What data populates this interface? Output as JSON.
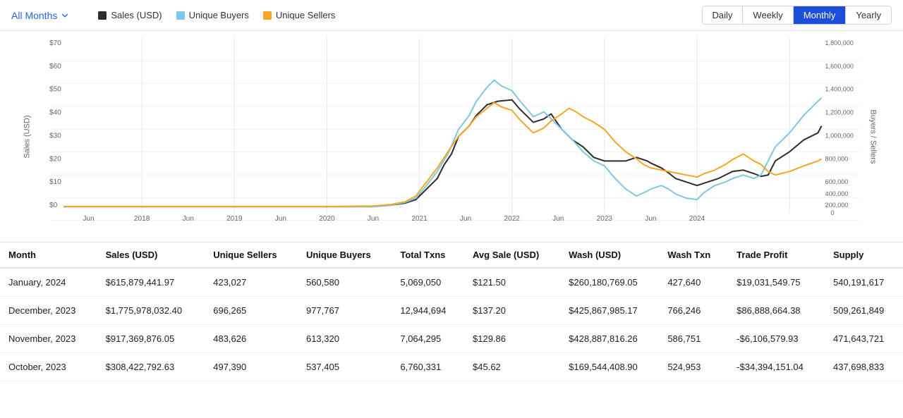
{
  "header": {
    "filter_label": "All Months",
    "period_buttons": [
      "Daily",
      "Weekly",
      "Monthly",
      "Yearly"
    ],
    "active_period": "Monthly"
  },
  "legend": [
    {
      "label": "Sales (USD)",
      "color": "#2d2d2d"
    },
    {
      "label": "Unique Buyers",
      "color": "#7ec8e3"
    },
    {
      "label": "Unique Sellers",
      "color": "#f5a623"
    }
  ],
  "chart": {
    "y_axis_left_label": "Sales (USD)",
    "y_axis_right_label": "Buyers / Sellers",
    "y_ticks_left": [
      "$70",
      "$60",
      "$50",
      "$40",
      "$30",
      "$20",
      "$10",
      "$0"
    ],
    "y_ticks_right": [
      "1,800,000",
      "1,600,000",
      "1,400,000",
      "1,200,000",
      "1,000,000",
      "800,000",
      "600,000",
      "400,000",
      "200,000",
      "0"
    ],
    "x_ticks": [
      "Jun",
      "2018",
      "Jun",
      "2019",
      "Jun",
      "2020",
      "Jun",
      "2021",
      "Jun",
      "2022",
      "Jun",
      "2023",
      "Jun",
      "2024"
    ]
  },
  "table": {
    "columns": [
      "Month",
      "Sales (USD)",
      "Unique Sellers",
      "Unique Buyers",
      "Total Txns",
      "Avg Sale (USD)",
      "Wash (USD)",
      "Wash Txn",
      "Trade Profit",
      "Supply"
    ],
    "rows": [
      [
        "January, 2024",
        "$615,879,441.97",
        "423,027",
        "560,580",
        "5,069,050",
        "$121.50",
        "$260,180,769.05",
        "427,640",
        "$19,031,549.75",
        "540,191,617"
      ],
      [
        "December, 2023",
        "$1,775,978,032.40",
        "696,265",
        "977,767",
        "12,944,694",
        "$137.20",
        "$425,867,985.17",
        "766,246",
        "$86,888,664.38",
        "509,261,849"
      ],
      [
        "November, 2023",
        "$917,369,876.05",
        "483,626",
        "613,320",
        "7,064,295",
        "$129.86",
        "$428,887,816.26",
        "586,751",
        "-$6,106,579.93",
        "471,643,721"
      ],
      [
        "October, 2023",
        "$308,422,792.63",
        "497,390",
        "537,405",
        "6,760,331",
        "$45.62",
        "$169,544,408.90",
        "524,953",
        "-$34,394,151.04",
        "437,698,833"
      ]
    ]
  }
}
